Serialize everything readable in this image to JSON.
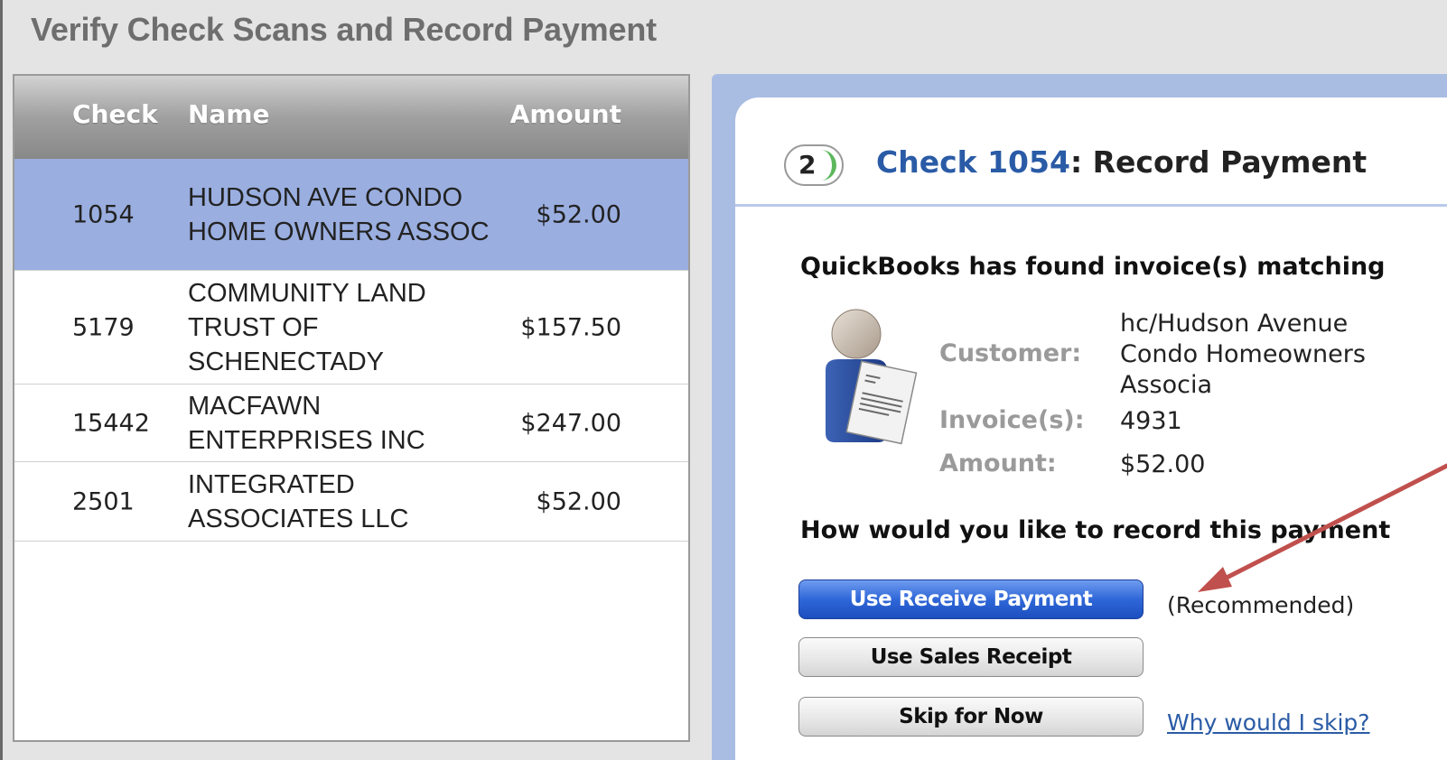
{
  "window": {
    "title": "Verify Check Scans and Record Payment"
  },
  "check_list": {
    "headers": {
      "check": "Check",
      "name": "Name",
      "amount": "Amount"
    },
    "rows": [
      {
        "check": "1054",
        "name": "HUDSON AVE CONDO HOME OWNERS ASSOC",
        "amount": "$52.00",
        "selected": true
      },
      {
        "check": "5179",
        "name": "COMMUNITY LAND TRUST OF SCHENECTADY",
        "amount": "$157.50",
        "selected": false
      },
      {
        "check": "15442",
        "name": "MACFAWN ENTERPRISES INC",
        "amount": "$247.00",
        "selected": false
      },
      {
        "check": "2501",
        "name": "INTEGRATED ASSOCIATES LLC",
        "amount": "$52.00",
        "selected": false
      }
    ]
  },
  "record_panel": {
    "step_number": "2",
    "title_link": "Check 1054",
    "title_rest": ": Record Payment",
    "found_text": "QuickBooks has found invoice(s) matching",
    "customer_icon": "customer-invoice-icon",
    "labels": {
      "customer": "Customer:",
      "invoices": "Invoice(s):",
      "amount": "Amount:"
    },
    "values": {
      "customer_line1": "hc/Hudson Avenue",
      "customer_line2": "Condo Homeowners",
      "customer_line3": "Associa",
      "invoices": "4931",
      "amount": "$52.00"
    },
    "question": "How would you like to record this payment",
    "buttons": {
      "receive_payment": "Use Receive Payment",
      "sales_receipt": "Use Sales Receipt",
      "skip": "Skip for Now"
    },
    "recommended_note": "(Recommended)",
    "why_skip_link": "Why would I skip?"
  },
  "colors": {
    "selected_row": "#9aaee0",
    "panel_border": "#a9bce2",
    "link": "#2a5ba6",
    "primary_button": "#2f67d8",
    "annotation_arrow": "#c0504d"
  }
}
